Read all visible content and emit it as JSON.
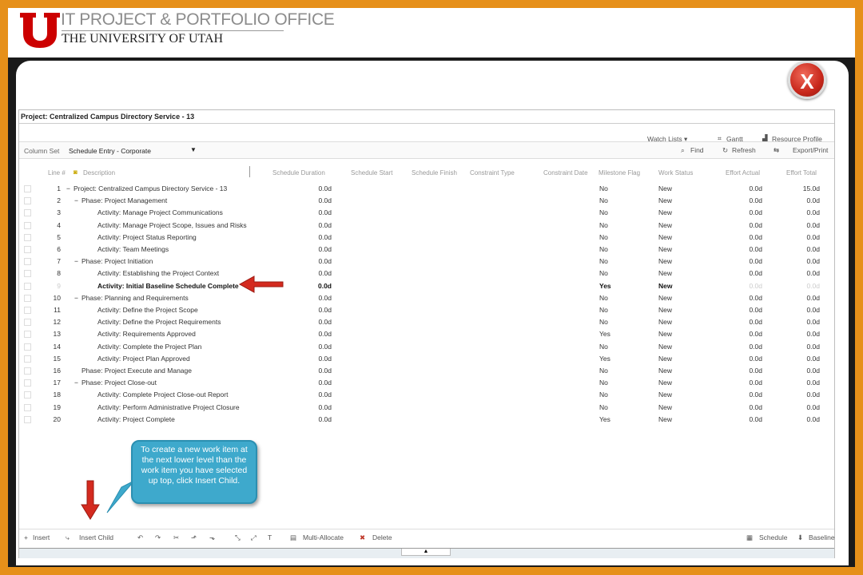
{
  "org": {
    "title": "IT PROJECT & PORTFOLIO OFFICE",
    "subtitle": "THE UNIVERSITY OF UTAH"
  },
  "window": {
    "close_label": "X"
  },
  "app": {
    "title": "Project: Centralized Campus Directory Service - 13",
    "toolbar_top": {
      "watch_lists": "Watch Lists ▾",
      "gantt": "Gantt",
      "resource_profile": "Resource Profile"
    },
    "column_set": {
      "label": "Column Set",
      "value": "Schedule Entry - Corporate",
      "find": "Find",
      "refresh": "Refresh",
      "export": "Export/Print"
    },
    "columns": [
      "Line #",
      "Description",
      "Schedule Duration",
      "Schedule Start",
      "Schedule Finish",
      "Constraint Type",
      "Constraint Date",
      "Milestone Flag",
      "Work Status",
      "Effort Actual",
      "Effort Total"
    ],
    "rows": [
      {
        "line": "1",
        "toggle": "−",
        "desc": "Project: Centralized Campus Directory Service - 13",
        "indent": 0,
        "duration": "0.0d",
        "milestone": "No",
        "status": "New",
        "actual": "0.0d",
        "total": "15.0d"
      },
      {
        "line": "2",
        "toggle": "−",
        "desc": "Phase: Project Management",
        "indent": 1,
        "duration": "0.0d",
        "milestone": "No",
        "status": "New",
        "actual": "0.0d",
        "total": "0.0d"
      },
      {
        "line": "3",
        "toggle": "",
        "desc": "Activity: Manage Project Communications",
        "indent": 2,
        "duration": "0.0d",
        "milestone": "No",
        "status": "New",
        "actual": "0.0d",
        "total": "0.0d"
      },
      {
        "line": "4",
        "toggle": "",
        "desc": "Activity: Manage Project Scope, Issues and Risks",
        "indent": 2,
        "duration": "0.0d",
        "milestone": "No",
        "status": "New",
        "actual": "0.0d",
        "total": "0.0d"
      },
      {
        "line": "5",
        "toggle": "",
        "desc": "Activity: Project Status Reporting",
        "indent": 2,
        "duration": "0.0d",
        "milestone": "No",
        "status": "New",
        "actual": "0.0d",
        "total": "0.0d"
      },
      {
        "line": "6",
        "toggle": "",
        "desc": "Activity: Team Meetings",
        "indent": 2,
        "duration": "0.0d",
        "milestone": "No",
        "status": "New",
        "actual": "0.0d",
        "total": "0.0d"
      },
      {
        "line": "7",
        "toggle": "−",
        "desc": "Phase: Project Initiation",
        "indent": 1,
        "duration": "0.0d",
        "milestone": "No",
        "status": "New",
        "actual": "0.0d",
        "total": "0.0d"
      },
      {
        "line": "8",
        "toggle": "",
        "desc": "Activity: Establishing the Project Context",
        "indent": 2,
        "duration": "0.0d",
        "milestone": "No",
        "status": "New",
        "actual": "0.0d",
        "total": "0.0d"
      },
      {
        "line": "9",
        "toggle": "",
        "desc": "Activity: Initial Baseline Schedule Complete",
        "indent": 2,
        "duration": "0.0d",
        "milestone": "Yes",
        "status": "New",
        "actual": "0.0d",
        "total": "0.0d",
        "bold": true
      },
      {
        "line": "10",
        "toggle": "−",
        "desc": "Phase: Planning and Requirements",
        "indent": 1,
        "duration": "0.0d",
        "milestone": "No",
        "status": "New",
        "actual": "0.0d",
        "total": "0.0d"
      },
      {
        "line": "11",
        "toggle": "",
        "desc": "Activity: Define the Project Scope",
        "indent": 2,
        "duration": "0.0d",
        "milestone": "No",
        "status": "New",
        "actual": "0.0d",
        "total": "0.0d"
      },
      {
        "line": "12",
        "toggle": "",
        "desc": "Activity: Define the Project Requirements",
        "indent": 2,
        "duration": "0.0d",
        "milestone": "No",
        "status": "New",
        "actual": "0.0d",
        "total": "0.0d"
      },
      {
        "line": "13",
        "toggle": "",
        "desc": "Activity: Requirements Approved",
        "indent": 2,
        "duration": "0.0d",
        "milestone": "Yes",
        "status": "New",
        "actual": "0.0d",
        "total": "0.0d"
      },
      {
        "line": "14",
        "toggle": "",
        "desc": "Activity: Complete the Project Plan",
        "indent": 2,
        "duration": "0.0d",
        "milestone": "No",
        "status": "New",
        "actual": "0.0d",
        "total": "0.0d"
      },
      {
        "line": "15",
        "toggle": "",
        "desc": "Activity: Project Plan Approved",
        "indent": 2,
        "duration": "0.0d",
        "milestone": "Yes",
        "status": "New",
        "actual": "0.0d",
        "total": "0.0d"
      },
      {
        "line": "16",
        "toggle": "",
        "desc": "Phase: Project Execute and Manage",
        "indent": 1,
        "duration": "0.0d",
        "milestone": "No",
        "status": "New",
        "actual": "0.0d",
        "total": "0.0d"
      },
      {
        "line": "17",
        "toggle": "−",
        "desc": "Phase: Project Close-out",
        "indent": 1,
        "duration": "0.0d",
        "milestone": "No",
        "status": "New",
        "actual": "0.0d",
        "total": "0.0d"
      },
      {
        "line": "18",
        "toggle": "",
        "desc": "Activity: Complete Project Close-out Report",
        "indent": 2,
        "duration": "0.0d",
        "milestone": "No",
        "status": "New",
        "actual": "0.0d",
        "total": "0.0d"
      },
      {
        "line": "19",
        "toggle": "",
        "desc": "Activity: Perform Administrative Project Closure",
        "indent": 2,
        "duration": "0.0d",
        "milestone": "No",
        "status": "New",
        "actual": "0.0d",
        "total": "0.0d"
      },
      {
        "line": "20",
        "toggle": "",
        "desc": "Activity: Project Complete",
        "indent": 2,
        "duration": "0.0d",
        "milestone": "Yes",
        "status": "New",
        "actual": "0.0d",
        "total": "0.0d"
      }
    ],
    "bottom_toolbar": {
      "insert": "Insert",
      "insert_child": "Insert Child",
      "multi_allocate": "Multi-Allocate",
      "delete": "Delete",
      "schedule": "Schedule",
      "baseline": "Baseline"
    }
  },
  "callout": {
    "text": "To create a new work item at the next lower level than the work item you have selected up top, click Insert Child."
  },
  "colors": {
    "orange_border": "#e6901a",
    "utah_red": "#cc0000",
    "callout_blue": "#3ea9cc",
    "arrow_red": "#d42a1f"
  }
}
